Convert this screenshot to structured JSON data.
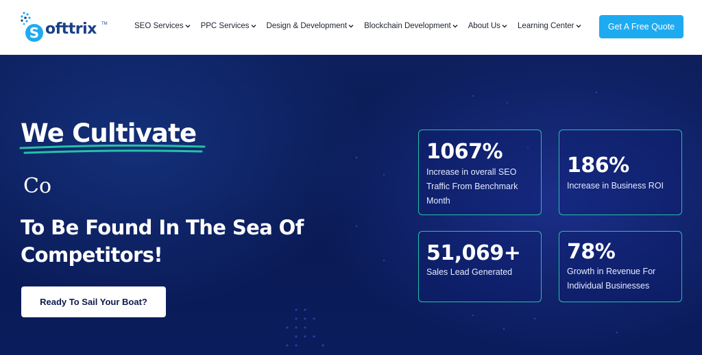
{
  "brand": {
    "name": "Softtrix",
    "name_rest": "ofttrix",
    "trademark": "TM",
    "colors": {
      "primary": "#1a3f86",
      "accent": "#1eaaf1",
      "teal": "#23c3a6",
      "hero_bg": "#0b1c5d"
    }
  },
  "nav": {
    "items": [
      {
        "label": "SEO Services",
        "icon": "chevron-down-icon"
      },
      {
        "label": "PPC Services",
        "icon": "chevron-down-icon"
      },
      {
        "label": "Design & Development",
        "icon": "chevron-down-icon"
      },
      {
        "label": "Blockchain Development",
        "icon": "chevron-down-icon"
      },
      {
        "label": "About Us",
        "icon": "chevron-down-icon"
      },
      {
        "label": "Learning Center",
        "icon": "chevron-down-icon"
      }
    ],
    "cta_label": "Get A Free Quote"
  },
  "hero": {
    "headline": "We Cultivate",
    "typed_text": "Co",
    "subhead_line1": "To Be Found In The Sea Of",
    "subhead_line2": "Competitors!",
    "cta_label": "Ready To Sail Your Boat?"
  },
  "stats": [
    {
      "value": "1067%",
      "desc": "Increase in overall SEO Traffic From Benchmark Month"
    },
    {
      "value": "186%",
      "desc": "Increase in Business ROI"
    },
    {
      "value": "51,069+",
      "desc": "Sales Lead Generated"
    },
    {
      "value": "78%",
      "desc": "Growth in Revenue For Individual Businesses"
    }
  ]
}
